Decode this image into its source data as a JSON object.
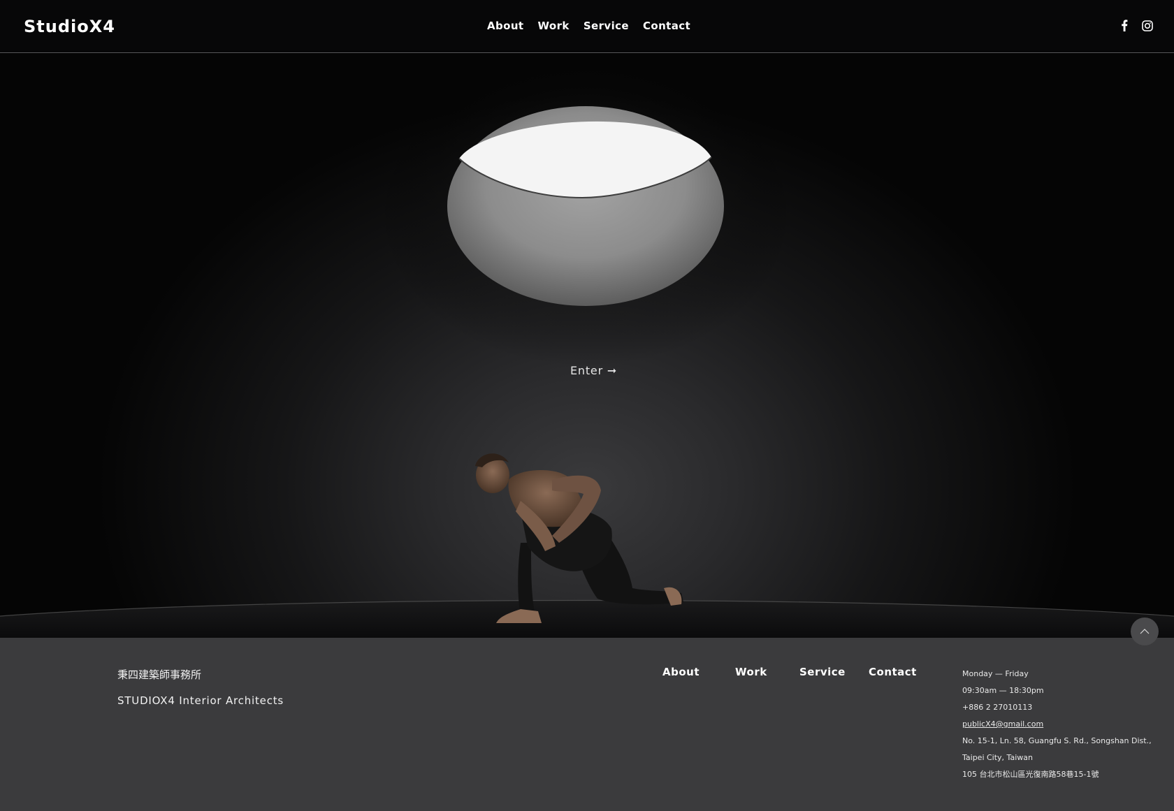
{
  "header": {
    "logo": "StudioX4",
    "nav": [
      {
        "label": "About"
      },
      {
        "label": "Work"
      },
      {
        "label": "Service"
      },
      {
        "label": "Contact"
      }
    ],
    "social": [
      "facebook-icon",
      "instagram-icon"
    ]
  },
  "hero": {
    "enter_label": "Enter ➞"
  },
  "footer": {
    "company_cn": "秉四建築師事務所",
    "company_en": "STUDIOX4 Interior Architects",
    "nav": [
      {
        "label": "About"
      },
      {
        "label": "Work"
      },
      {
        "label": "Service"
      },
      {
        "label": "Contact"
      }
    ],
    "contact": {
      "days": "Monday — Friday",
      "hours": "09:30am — 18:30pm",
      "phone": "+886 2 27010113",
      "email": "publicX4@gmail.com",
      "address_line1": "No. 15-1, Ln. 58, Guangfu S. Rd., Songshan Dist.,",
      "address_line2": "Taipei City, Taiwan",
      "address_cn": "105 台北市松山區光復南路58巷15-1號"
    }
  },
  "scroll_top_icon": "chevron-up-icon",
  "colors": {
    "header_bg": "#070708",
    "footer_bg": "#3b3b3d",
    "text": "#ffffff"
  }
}
